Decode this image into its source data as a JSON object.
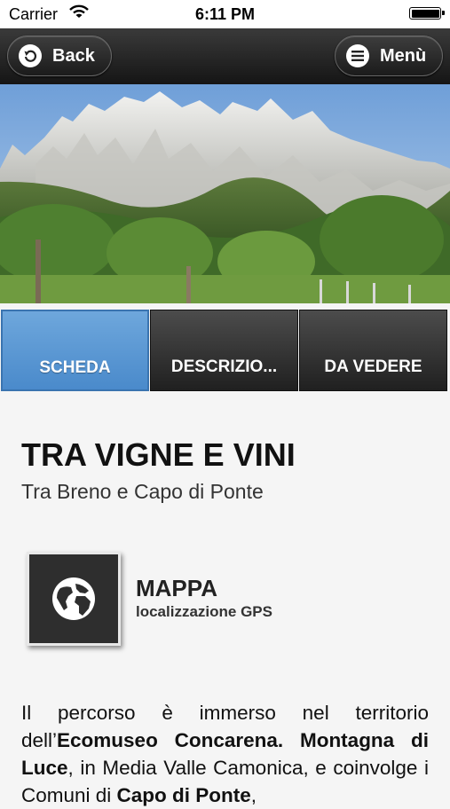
{
  "status_bar": {
    "carrier": "Carrier",
    "time": "6:11 PM"
  },
  "nav": {
    "back_label": "Back",
    "menu_label": "Menù"
  },
  "tabs": [
    {
      "label": "SCHEDA",
      "active": true
    },
    {
      "label": "DESCRIZIO...",
      "active": false
    },
    {
      "label": "DA VEDERE",
      "active": false
    }
  ],
  "content": {
    "title": "TRA VIGNE E VINI",
    "subtitle": "Tra Breno e Capo di Ponte",
    "map": {
      "title": "MAPPA",
      "subtitle": "localizzazione GPS",
      "icon": "globe-icon"
    },
    "paragraph": [
      {
        "text": "Il percorso è immerso nel territorio dell’",
        "bold": false
      },
      {
        "text": "Ecomuseo Concarena. Montagna di Luce",
        "bold": true
      },
      {
        "text": ", in Media Valle Camonica, e coinvolge i Comuni di ",
        "bold": false
      },
      {
        "text": "Capo di Ponte",
        "bold": true
      },
      {
        "text": ",",
        "bold": false
      }
    ]
  },
  "colors": {
    "active_tab": "#5b9ad5",
    "navbar": "#1f1f1f"
  }
}
